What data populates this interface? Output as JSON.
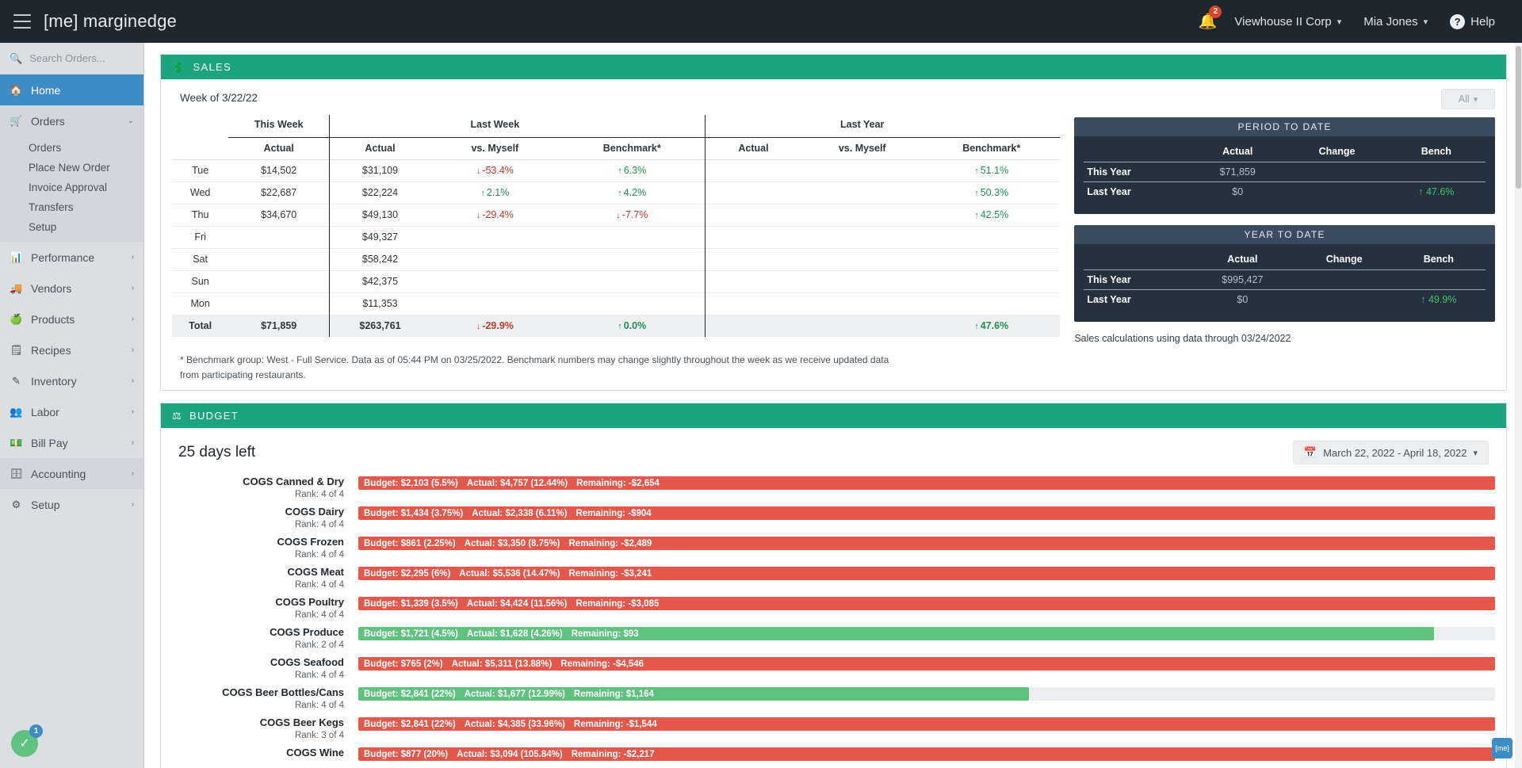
{
  "topbar": {
    "brand": "[me] marginedge",
    "menu_icon": "hamburger-icon",
    "notifications": {
      "icon": "bell-icon",
      "count": "2"
    },
    "company": "Viewhouse II Corp",
    "user": "Mia Jones",
    "help": "Help",
    "help_icon": "question-mark-icon"
  },
  "sidebar": {
    "search_placeholder": "Search Orders...",
    "items": [
      {
        "label": "Home",
        "icon": "home-icon",
        "state": "active",
        "chev": ""
      },
      {
        "label": "Orders",
        "icon": "truck-icon",
        "state": "open",
        "chev": "⌄"
      },
      {
        "label": "Performance",
        "icon": "bar-chart-icon",
        "state": "",
        "chev": "›"
      },
      {
        "label": "Vendors",
        "icon": "delivery-truck-icon",
        "state": "",
        "chev": "›"
      },
      {
        "label": "Products",
        "icon": "apple-icon",
        "state": "",
        "chev": "›"
      },
      {
        "label": "Recipes",
        "icon": "list-icon",
        "state": "",
        "chev": "›"
      },
      {
        "label": "Inventory",
        "icon": "edit-square-icon",
        "state": "",
        "chev": "›"
      },
      {
        "label": "Labor",
        "icon": "people-icon",
        "state": "",
        "chev": "›"
      },
      {
        "label": "Bill Pay",
        "icon": "money-card-icon",
        "state": "",
        "chev": "›"
      },
      {
        "label": "Accounting",
        "icon": "archive-icon",
        "state": "hover",
        "chev": "›"
      },
      {
        "label": "Setup",
        "icon": "gear-icon",
        "state": "",
        "chev": "›"
      }
    ],
    "orders_subnav": [
      "Orders",
      "Place New Order",
      "Invoice Approval",
      "Transfers",
      "Setup"
    ]
  },
  "sales": {
    "header": "SALES",
    "header_icon": "money-bill-icon",
    "week_label": "Week of 3/22/22",
    "filter_label": "All",
    "group_headers": [
      "This Week",
      "Last Week",
      "Last Year"
    ],
    "sub_headers": [
      "Actual",
      "Actual",
      "vs. Myself",
      "Benchmark*",
      "Actual",
      "vs. Myself",
      "Benchmark*"
    ],
    "rows": [
      {
        "day": "Tue",
        "tw_actual": "$14,502",
        "lw_actual": "$31,109",
        "lw_vs": "-53.4%",
        "lw_vs_dir": "down",
        "lw_bench": "6.3%",
        "lw_bench_dir": "up",
        "ly_actual": "",
        "ly_vs": "",
        "ly_bench": "51.1%",
        "ly_bench_dir": "up"
      },
      {
        "day": "Wed",
        "tw_actual": "$22,687",
        "lw_actual": "$22,224",
        "lw_vs": "2.1%",
        "lw_vs_dir": "up",
        "lw_bench": "4.2%",
        "lw_bench_dir": "up",
        "ly_actual": "",
        "ly_vs": "",
        "ly_bench": "50.3%",
        "ly_bench_dir": "up"
      },
      {
        "day": "Thu",
        "tw_actual": "$34,670",
        "lw_actual": "$49,130",
        "lw_vs": "-29.4%",
        "lw_vs_dir": "down",
        "lw_bench": "-7.7%",
        "lw_bench_dir": "down",
        "ly_actual": "",
        "ly_vs": "",
        "ly_bench": "42.5%",
        "ly_bench_dir": "up"
      },
      {
        "day": "Fri",
        "tw_actual": "",
        "lw_actual": "$49,327",
        "lw_vs": "",
        "lw_vs_dir": "",
        "lw_bench": "",
        "lw_bench_dir": "",
        "ly_actual": "",
        "ly_vs": "",
        "ly_bench": "",
        "ly_bench_dir": ""
      },
      {
        "day": "Sat",
        "tw_actual": "",
        "lw_actual": "$58,242",
        "lw_vs": "",
        "lw_vs_dir": "",
        "lw_bench": "",
        "lw_bench_dir": "",
        "ly_actual": "",
        "ly_vs": "",
        "ly_bench": "",
        "ly_bench_dir": ""
      },
      {
        "day": "Sun",
        "tw_actual": "",
        "lw_actual": "$42,375",
        "lw_vs": "",
        "lw_vs_dir": "",
        "lw_bench": "",
        "lw_bench_dir": "",
        "ly_actual": "",
        "ly_vs": "",
        "ly_bench": "",
        "ly_bench_dir": ""
      },
      {
        "day": "Mon",
        "tw_actual": "",
        "lw_actual": "$11,353",
        "lw_vs": "",
        "lw_vs_dir": "",
        "lw_bench": "",
        "lw_bench_dir": "",
        "ly_actual": "",
        "ly_vs": "",
        "ly_bench": "",
        "ly_bench_dir": ""
      }
    ],
    "total": {
      "day": "Total",
      "tw_actual": "$71,859",
      "lw_actual": "$263,761",
      "lw_vs": "-29.9%",
      "lw_vs_dir": "down",
      "lw_bench": "0.0%",
      "lw_bench_dir": "up",
      "ly_actual": "",
      "ly_vs": "",
      "ly_bench": "47.6%",
      "ly_bench_dir": "up"
    },
    "footnote": "* Benchmark group: West - Full Service. Data as of 05:44 PM on 03/25/2022. Benchmark numbers may change slightly throughout the week as we receive updated data from participating restaurants.",
    "period_to_date": {
      "title": "PERIOD TO DATE",
      "columns": [
        "Actual",
        "Change",
        "Bench"
      ],
      "rows": [
        {
          "label": "This Year",
          "actual": "$71,859",
          "change": "",
          "bench": "",
          "bench_dir": ""
        },
        {
          "label": "Last Year",
          "actual": "$0",
          "change": "",
          "bench": "47.6%",
          "bench_dir": "up"
        }
      ]
    },
    "year_to_date": {
      "title": "YEAR TO DATE",
      "columns": [
        "Actual",
        "Change",
        "Bench"
      ],
      "rows": [
        {
          "label": "This Year",
          "actual": "$995,427",
          "change": "",
          "bench": "",
          "bench_dir": ""
        },
        {
          "label": "Last Year",
          "actual": "$0",
          "change": "",
          "bench": "49.9%",
          "bench_dir": "up"
        }
      ]
    },
    "calc_note": "Sales calculations using data through 03/24/2022"
  },
  "budget": {
    "header": "BUDGET",
    "header_icon": "scales-icon",
    "days_left": "25 days left",
    "date_range": "March 22, 2022 - April 18, 2022",
    "calendar_icon": "calendar-icon",
    "rows": [
      {
        "name": "COGS Canned & Dry",
        "rank": "Rank: 4 of 4",
        "budget": "Budget: $2,103 (5.5%)",
        "actual": "Actual: $4,757 (12.44%)",
        "remaining": "Remaining: -$2,654",
        "status": "red",
        "fill_pct": 100
      },
      {
        "name": "COGS Dairy",
        "rank": "Rank: 4 of 4",
        "budget": "Budget: $1,434 (3.75%)",
        "actual": "Actual: $2,338 (6.11%)",
        "remaining": "Remaining: -$904",
        "status": "red",
        "fill_pct": 100
      },
      {
        "name": "COGS Frozen",
        "rank": "Rank: 4 of 4",
        "budget": "Budget: $861 (2.25%)",
        "actual": "Actual: $3,350 (8.75%)",
        "remaining": "Remaining: -$2,489",
        "status": "red",
        "fill_pct": 100
      },
      {
        "name": "COGS Meat",
        "rank": "Rank: 4 of 4",
        "budget": "Budget: $2,295 (6%)",
        "actual": "Actual: $5,536 (14.47%)",
        "remaining": "Remaining: -$3,241",
        "status": "red",
        "fill_pct": 100
      },
      {
        "name": "COGS Poultry",
        "rank": "Rank: 4 of 4",
        "budget": "Budget: $1,339 (3.5%)",
        "actual": "Actual: $4,424 (11.56%)",
        "remaining": "Remaining: -$3,085",
        "status": "red",
        "fill_pct": 100
      },
      {
        "name": "COGS Produce",
        "rank": "Rank: 2 of 4",
        "budget": "Budget: $1,721 (4.5%)",
        "actual": "Actual: $1,628 (4.26%)",
        "remaining": "Remaining: $93",
        "status": "green",
        "fill_pct": 94.6
      },
      {
        "name": "COGS Seafood",
        "rank": "Rank: 4 of 4",
        "budget": "Budget: $765 (2%)",
        "actual": "Actual: $5,311 (13.88%)",
        "remaining": "Remaining: -$4,546",
        "status": "red",
        "fill_pct": 100
      },
      {
        "name": "COGS Beer Bottles/Cans",
        "rank": "Rank: 4 of 4",
        "budget": "Budget: $2,841 (22%)",
        "actual": "Actual: $1,677 (12.99%)",
        "remaining": "Remaining: $1,164",
        "status": "green",
        "fill_pct": 59
      },
      {
        "name": "COGS Beer Kegs",
        "rank": "Rank: 3 of 4",
        "budget": "Budget: $2,841 (22%)",
        "actual": "Actual: $4,385 (33.96%)",
        "remaining": "Remaining: -$1,544",
        "status": "red",
        "fill_pct": 100
      },
      {
        "name": "COGS Wine",
        "rank": "",
        "budget": "Budget: $877 (20%)",
        "actual": "Actual: $3,094 (105.84%)",
        "remaining": "Remaining: -$2,217",
        "status": "red",
        "fill_pct": 100
      }
    ]
  },
  "widgets": {
    "chat_icon": "chat-check-icon",
    "chat_count": "1",
    "me_bubble_label": "[me]"
  },
  "colors": {
    "brand_green": "#1ca37f",
    "accent_blue": "#3c8dc5",
    "topbar_dark": "#1e2630",
    "panel_dark": "#26313f",
    "panel_title": "#3a4b60",
    "up_green": "#1f9254",
    "down_red": "#c0392b",
    "bar_red": "#e3584b",
    "bar_green": "#5fc27e",
    "badge_red": "#d9442b"
  }
}
